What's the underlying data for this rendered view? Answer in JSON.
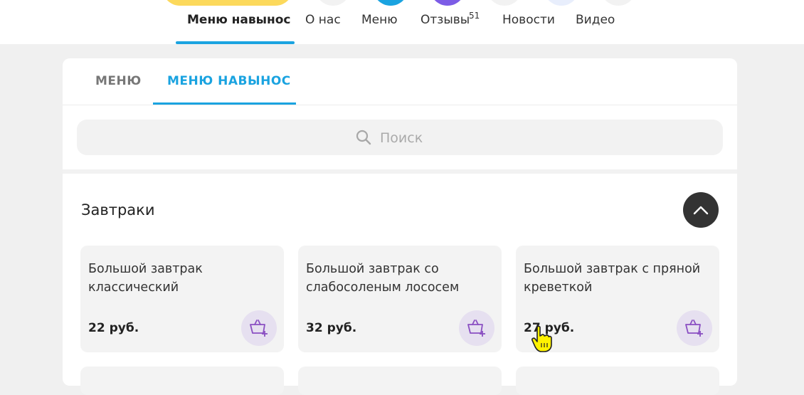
{
  "nav": {
    "links": [
      {
        "label": "Меню навынос",
        "active": true
      },
      {
        "label": "О нас"
      },
      {
        "label": "Меню"
      },
      {
        "label": "Отзывы",
        "badge": "51"
      },
      {
        "label": "Новости"
      },
      {
        "label": "Видео"
      }
    ]
  },
  "tabs": [
    {
      "label": "МЕНЮ"
    },
    {
      "label": "МЕНЮ НАВЫНОС",
      "active": true
    }
  ],
  "search": {
    "placeholder": "Поиск",
    "value": ""
  },
  "section": {
    "title": "Завтраки"
  },
  "items": [
    {
      "title": "Большой завтрак классический",
      "price": "22 руб."
    },
    {
      "title": "Большой завтрак со слабосоленым лососем",
      "price": "32 руб."
    },
    {
      "title": "Большой завтрак с пряной креветкой",
      "price": "27 руб."
    }
  ],
  "colors": {
    "accent": "#1aa3e0",
    "cart": "#8a4fc2",
    "highlight": "#fcd95c"
  },
  "icons": {
    "search": "search-icon",
    "collapse": "chevron-up-icon",
    "cart": "basket-add-icon"
  }
}
